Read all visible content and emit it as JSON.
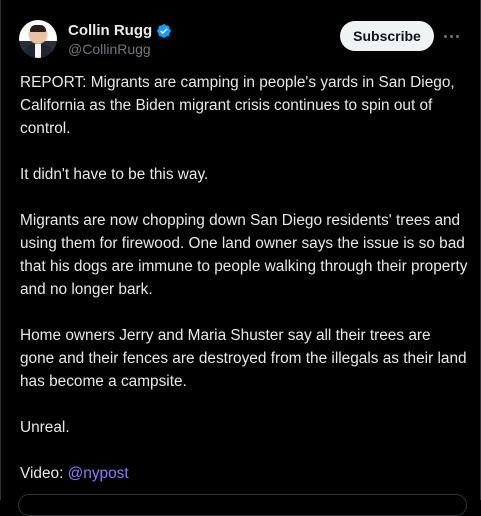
{
  "author": {
    "display_name": "Collin Rugg",
    "handle": "@CollinRugg",
    "verified": true
  },
  "actions": {
    "subscribe_label": "Subscribe",
    "more_icon": "more-horizontal-icon"
  },
  "tweet": {
    "paragraphs": [
      "REPORT: Migrants are camping in people's yards in San Diego, California as the Biden migrant crisis continues to spin out of control.",
      "It didn't have to be this way.",
      "Migrants are now chopping down San Diego residents' trees and using them for firewood. One land owner says the issue is so bad that his dogs are immune to people walking through their property and no longer bark.",
      "Home owners Jerry and Maria Shuster say all their trees are gone and their fences are destroyed from the illegals as their land has become a campsite.",
      "Unreal."
    ],
    "video_prefix": "Video: ",
    "video_mention": "@nypost"
  },
  "colors": {
    "background": "#000000",
    "text": "#e7e9ea",
    "secondary_text": "#71767b",
    "verified_badge": "#1d9bf0",
    "mention": "#8f7cf8",
    "button_bg": "#eff3f4"
  }
}
